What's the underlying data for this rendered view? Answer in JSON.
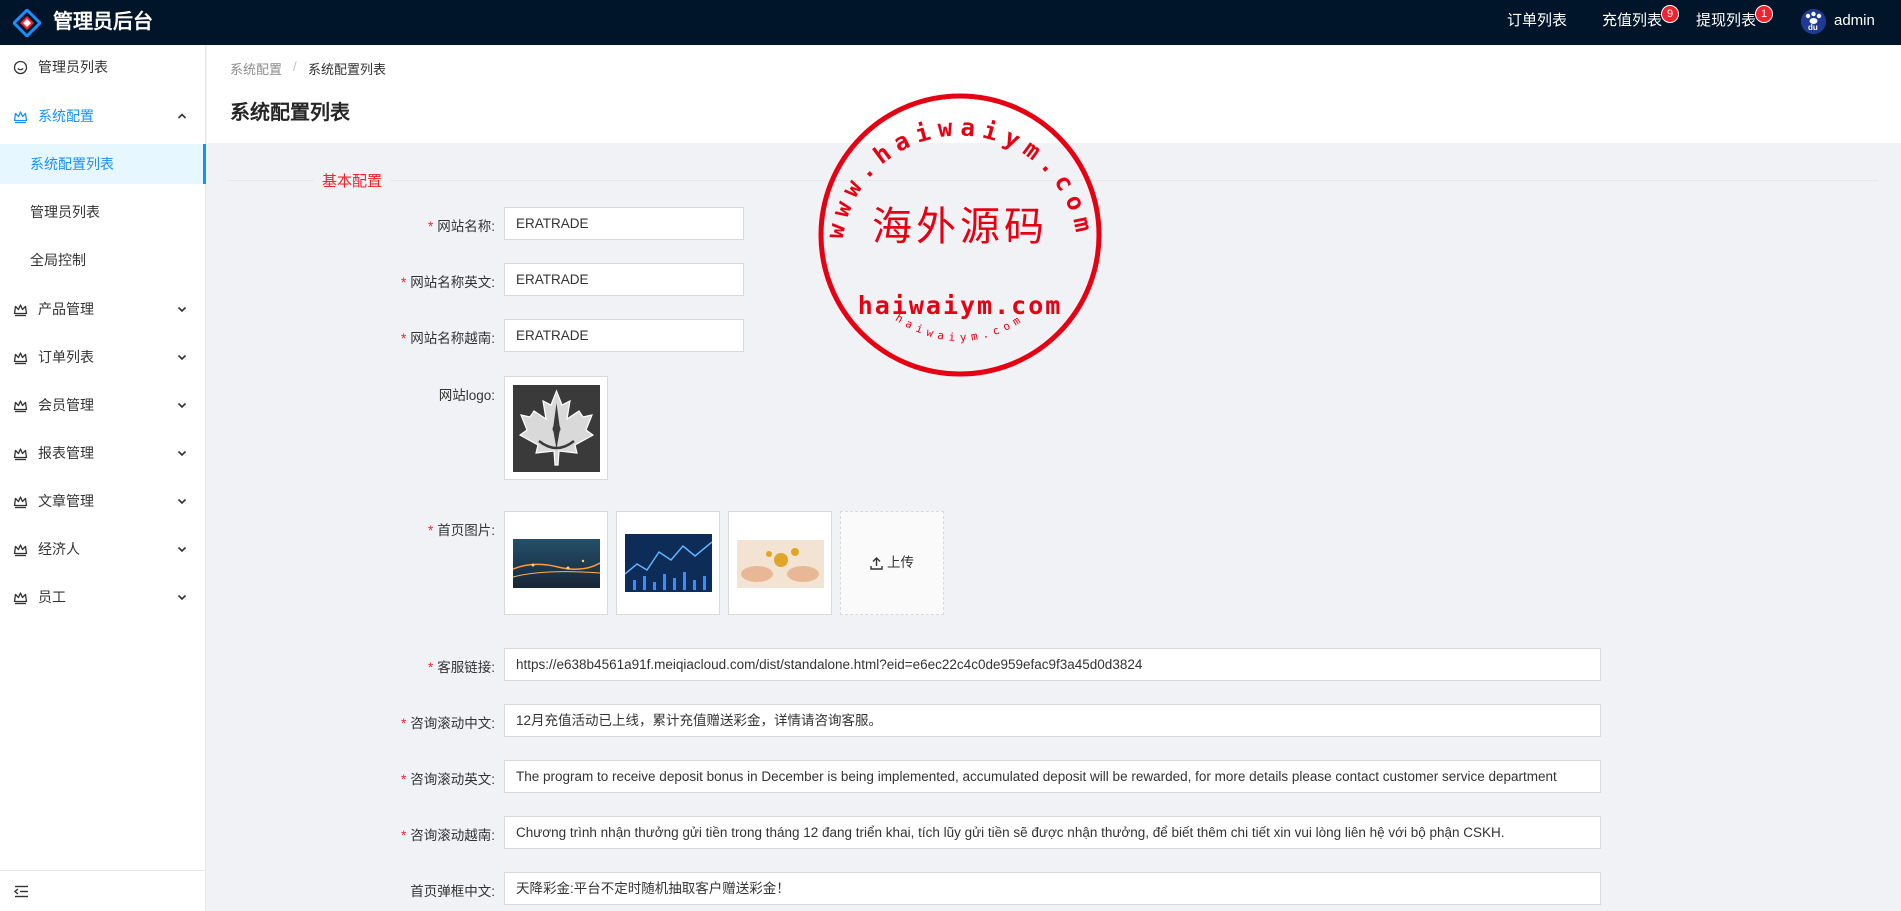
{
  "app": {
    "title": "管理员后台"
  },
  "header_nav": [
    {
      "label": "订单列表",
      "badge": ""
    },
    {
      "label": "充值列表",
      "badge": "9"
    },
    {
      "label": "提现列表",
      "badge": "1"
    }
  ],
  "user": {
    "name": "admin",
    "avatar_text": "du"
  },
  "sidebar": {
    "items": [
      {
        "label": "管理员列表",
        "icon": "smile-icon"
      },
      {
        "label": "系统配置",
        "icon": "crown-icon",
        "open": true
      },
      {
        "label": "产品管理",
        "icon": "crown-icon"
      },
      {
        "label": "订单列表",
        "icon": "crown-icon"
      },
      {
        "label": "会员管理",
        "icon": "crown-icon"
      },
      {
        "label": "报表管理",
        "icon": "crown-icon"
      },
      {
        "label": "文章管理",
        "icon": "crown-icon"
      },
      {
        "label": "经济人",
        "icon": "crown-icon"
      },
      {
        "label": "员工",
        "icon": "crown-icon"
      }
    ],
    "sub_items": [
      {
        "label": "系统配置列表",
        "active": true
      },
      {
        "label": "管理员列表"
      },
      {
        "label": "全局控制"
      }
    ]
  },
  "breadcrumb": {
    "parent": "系统配置",
    "separator": "/",
    "current": "系统配置列表"
  },
  "page_title": "系统配置列表",
  "section": {
    "title": "基本配置"
  },
  "form": {
    "site_name": {
      "label": "网站名称:",
      "value": "ERATRADE",
      "required": true
    },
    "site_name_en": {
      "label": "网站名称英文:",
      "value": "ERATRADE",
      "required": true
    },
    "site_name_vi": {
      "label": "网站名称越南:",
      "value": "ERATRADE",
      "required": true
    },
    "site_logo": {
      "label": "网站logo:",
      "required": false
    },
    "home_images": {
      "label": "首页图片:",
      "required": true,
      "upload_label": "上传"
    },
    "service_link": {
      "label": "客服链接:",
      "value": "https://e638b4561a91f.meiqiacloud.com/dist/standalone.html?eid=e6ec22c4c0de959efac9f3a45d0d3824",
      "required": true
    },
    "scroll_cn": {
      "label": "咨询滚动中文:",
      "value": "12月充值活动已上线，累计充值赠送彩金，详情请咨询客服。",
      "required": true
    },
    "scroll_en": {
      "label": "咨询滚动英文:",
      "value": "The program to receive deposit bonus in December is being implemented, accumulated deposit will be rewarded, for more details please contact customer service department",
      "required": true
    },
    "scroll_vi": {
      "label": "咨询滚动越南:",
      "value": "Chương trình nhận thưởng gửi tiền trong tháng 12 đang triển khai, tích lũy gửi tiền sẽ được nhận thưởng, để biết thêm chi tiết xin vui lòng liên hệ với bộ phận CSKH.",
      "required": true
    },
    "popup_cn": {
      "label": "首页弹框中文:",
      "value": "天降彩金:平台不定时随机抽取客户赠送彩金！",
      "required": false
    }
  },
  "watermark": {
    "ring_text": "www.haiwaiym.com",
    "center_text": "海外源码",
    "domain_text": "haiwaiym.com",
    "small_text": "haiwaiym.com",
    "color": "#e60012"
  },
  "colors": {
    "primary": "#1890ff",
    "header_bg": "#001529",
    "required": "#f5222d"
  }
}
